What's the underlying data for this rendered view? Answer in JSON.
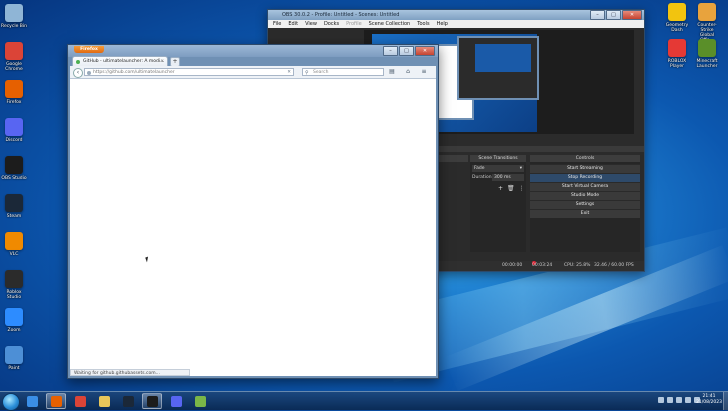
{
  "desktop_icons_left": [
    {
      "label": "Recycle Bin",
      "icon": "recycle-bin-icon",
      "color": "#8fb5d6"
    },
    {
      "label": "Google Chrome",
      "icon": "chrome-icon",
      "color": "#db4437"
    },
    {
      "label": "Firefox",
      "icon": "firefox-icon",
      "color": "#e66000"
    },
    {
      "label": "Discord",
      "icon": "discord-icon",
      "color": "#5865f2"
    },
    {
      "label": "OBS Studio",
      "icon": "obs-icon",
      "color": "#1c1c1c"
    },
    {
      "label": "Steam",
      "icon": "steam-icon",
      "color": "#1b2838"
    },
    {
      "label": "VLC",
      "icon": "vlc-icon",
      "color": "#f08a00"
    },
    {
      "label": "Roblox Studio",
      "icon": "roblox-studio-icon",
      "color": "#2b2b2b"
    },
    {
      "label": "Zoom",
      "icon": "zoom-icon",
      "color": "#2d8cff"
    },
    {
      "label": "Paint",
      "icon": "paint-icon",
      "color": "#4d8fd6"
    }
  ],
  "desktop_icons_right": [
    {
      "label": "Geometry Dash",
      "icon": "geometry-dash-icon",
      "color": "#f2c40f"
    },
    {
      "label": "Counter-Strike Global Offe...",
      "icon": "csgo-icon",
      "color": "#e8a33d"
    },
    {
      "label": "ROBLOX Player",
      "icon": "roblox-icon",
      "color": "#e53935"
    },
    {
      "label": "Minecraft Launcher",
      "icon": "minecraft-icon",
      "color": "#5a8f29"
    }
  ],
  "obs": {
    "title": "OBS 30.0.2 - Profile: Untitled - Scenes: Untitled",
    "menu": [
      "File",
      "Edit",
      "View",
      "Docks",
      "Profile",
      "Scene Collection",
      "Tools",
      "Help"
    ],
    "scene_transitions": {
      "header": "Scene Transitions",
      "transition": "Fade",
      "duration_label": "Duration",
      "duration_value": "300 ms"
    },
    "controls": {
      "header": "Controls",
      "buttons": [
        "Start Streaming",
        "Stop Recording",
        "Start Virtual Camera",
        "Studio Mode",
        "Settings",
        "Exit"
      ]
    },
    "status": {
      "stream_time": "00:00:00",
      "rec_time": "00:03:24",
      "cpu": "CPU: 25.8%",
      "fps": "32.46 / 60.00 FPS"
    }
  },
  "firefox": {
    "brand": "Firefox",
    "tab_title": "GitHub - ultimatelauncher: A modi...",
    "url": "https://github.com/ultimatelauncher",
    "search_placeholder": "Search",
    "status_text": "Waiting for github.githubassets.com..."
  },
  "taskbar": {
    "items": [
      {
        "icon": "ie-icon",
        "color": "#3a8ee6"
      },
      {
        "icon": "firefox-icon",
        "color": "#e66000"
      },
      {
        "icon": "chrome-icon",
        "color": "#db4437"
      },
      {
        "icon": "explorer-icon",
        "color": "#e8c65a"
      },
      {
        "icon": "steam-icon",
        "color": "#1b2838"
      },
      {
        "icon": "obs-icon",
        "color": "#1c1c1c"
      },
      {
        "icon": "discord-icon",
        "color": "#5865f2"
      },
      {
        "icon": "notepad-icon",
        "color": "#7ab648"
      }
    ],
    "time": "21:41",
    "date": "21/08/2023"
  }
}
